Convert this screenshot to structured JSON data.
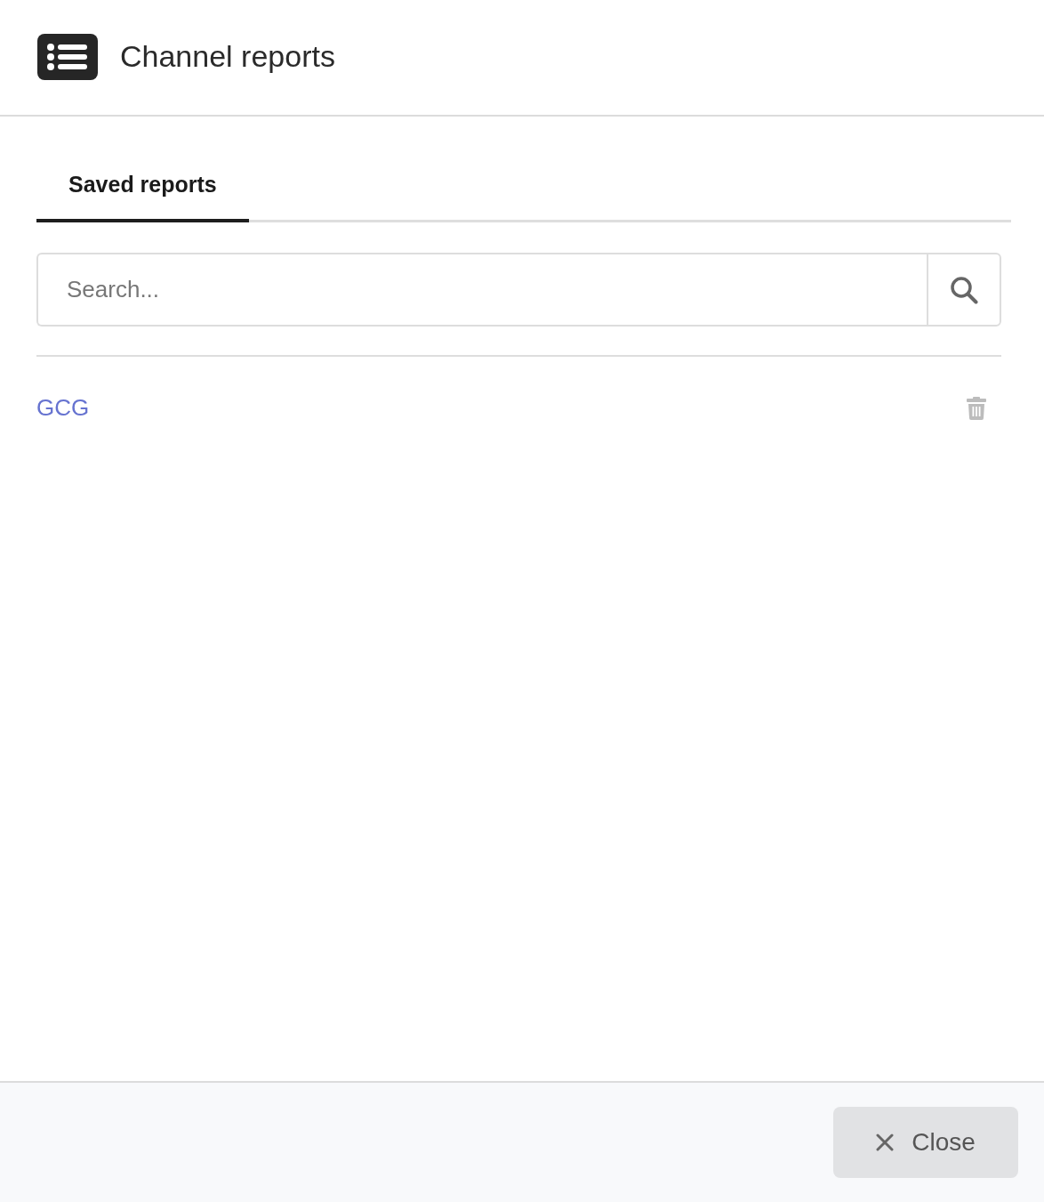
{
  "header": {
    "title": "Channel reports"
  },
  "tabs": [
    {
      "label": "Saved reports",
      "selected": true
    }
  ],
  "search": {
    "placeholder": "Search..."
  },
  "reports": [
    {
      "name": "GCG"
    }
  ],
  "footer": {
    "close_button": {
      "label": "Close"
    }
  }
}
